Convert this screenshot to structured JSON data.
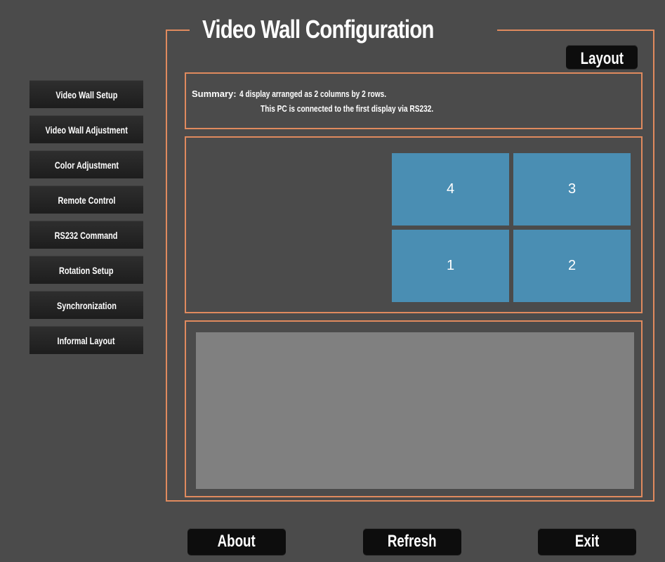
{
  "title": "Video Wall Configuration",
  "layout_button": "Layout",
  "sidebar": {
    "items": [
      {
        "label": "Video Wall Setup"
      },
      {
        "label": "Video Wall Adjustment"
      },
      {
        "label": "Color Adjustment"
      },
      {
        "label": "Remote Control"
      },
      {
        "label": "RS232 Command"
      },
      {
        "label": "Rotation Setup"
      },
      {
        "label": "Synchronization"
      },
      {
        "label": "Informal Layout"
      }
    ]
  },
  "summary": {
    "label": "Summary:",
    "line1": "4 display arranged as 2 columns by 2 rows.",
    "line2": "This PC is connected to the first display via RS232."
  },
  "displays": [
    "4",
    "3",
    "1",
    "2"
  ],
  "buttons": {
    "about": "About",
    "refresh": "Refresh",
    "exit": "Exit"
  },
  "colors": {
    "accent": "#e08a5e",
    "display_tile": "#4a8eb3",
    "background": "#4b4b4b"
  }
}
